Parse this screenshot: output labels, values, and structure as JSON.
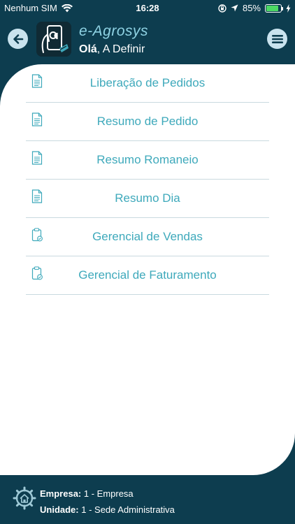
{
  "status_bar": {
    "carrier": "Nenhum SIM",
    "time": "16:28",
    "battery_percent": "85%",
    "battery_level": 0.85
  },
  "header": {
    "app_name": "e-Agrosys",
    "greeting_prefix": "Olá",
    "greeting_name": ", A Definir"
  },
  "menu": {
    "items": [
      {
        "label": "Liberação de Pedidos",
        "icon": "document-icon"
      },
      {
        "label": "Resumo de Pedido",
        "icon": "document-icon"
      },
      {
        "label": "Resumo Romaneio",
        "icon": "document-icon"
      },
      {
        "label": "Resumo Dia",
        "icon": "document-icon"
      },
      {
        "label": "Gerencial de Vendas",
        "icon": "clipboard-check-icon"
      },
      {
        "label": "Gerencial de Faturamento",
        "icon": "clipboard-check-icon"
      }
    ]
  },
  "footer": {
    "empresa_label": "Empresa:",
    "empresa_value": " 1 - Empresa",
    "unidade_label": "Unidade:",
    "unidade_value": " 1 - Sede Administrativa"
  },
  "colors": {
    "primary_dark": "#0d3d4f",
    "accent": "#3ea9bb",
    "button_bg": "#c9e3ee"
  }
}
